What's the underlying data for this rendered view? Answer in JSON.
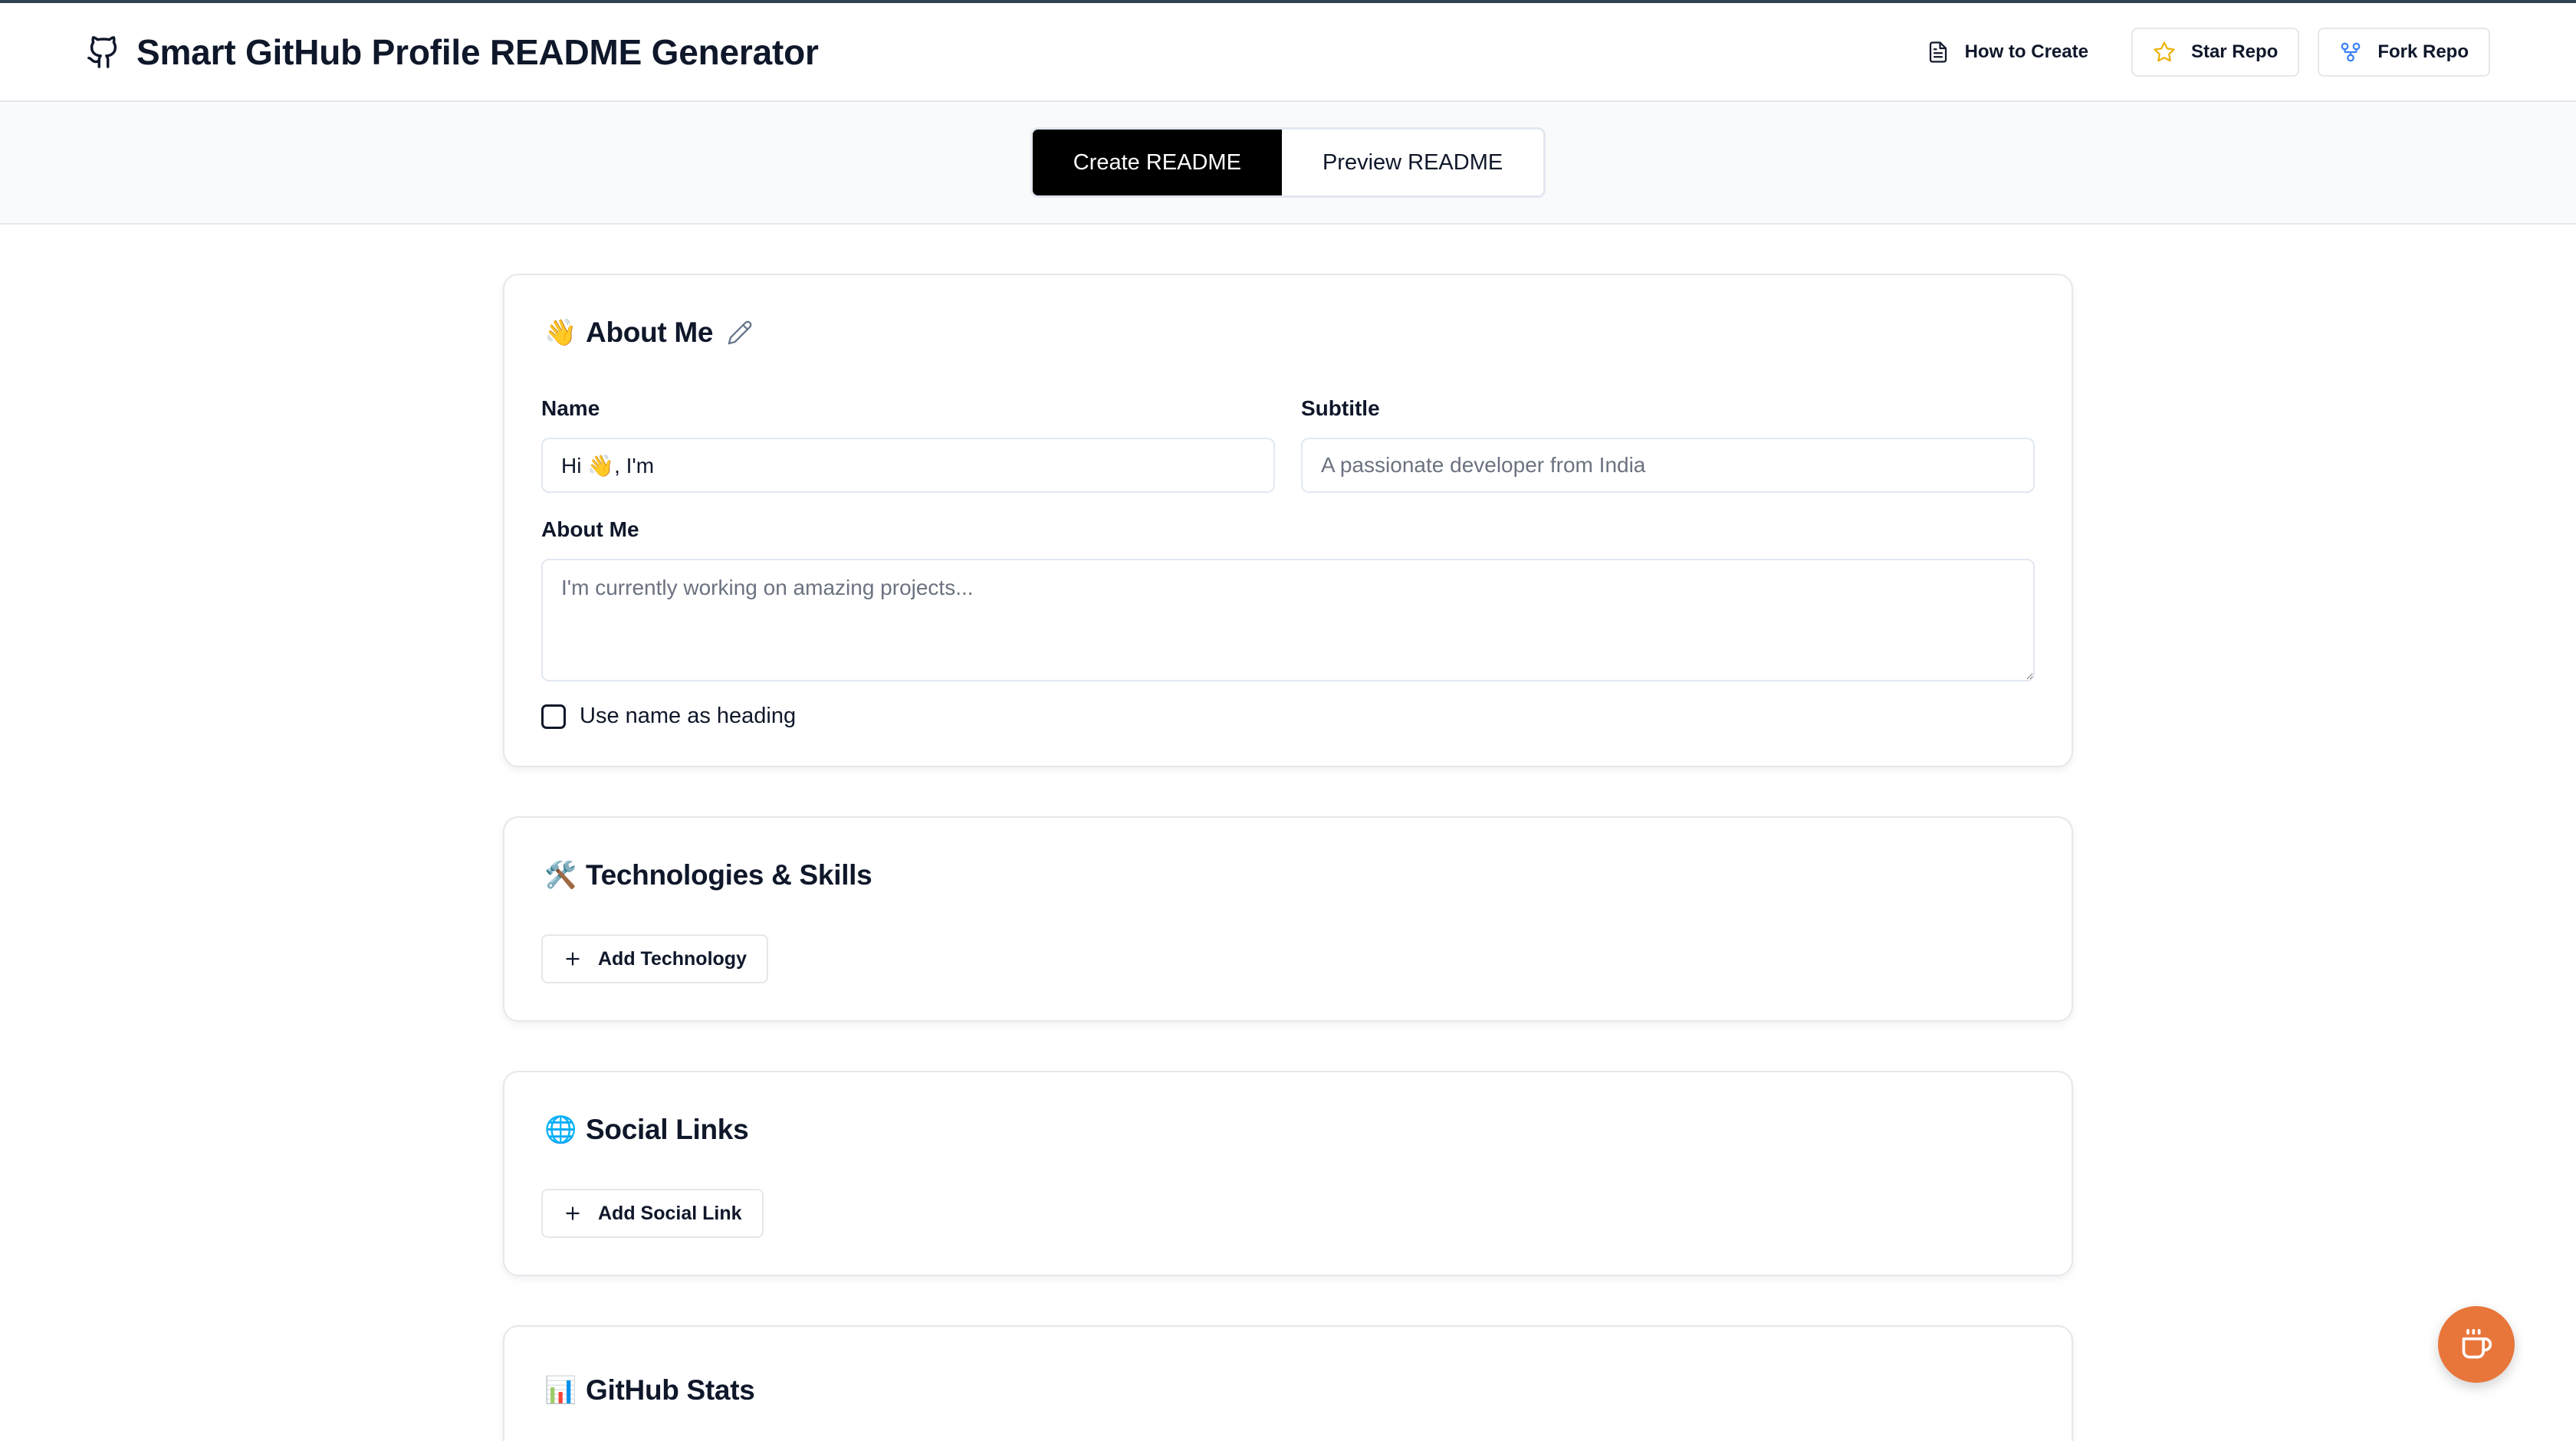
{
  "header": {
    "title": "Smart GitHub Profile README Generator",
    "how_to_label": "How to Create",
    "star_label": "Star Repo",
    "fork_label": "Fork Repo"
  },
  "tabs": [
    {
      "label": "Create README",
      "active": true
    },
    {
      "label": "Preview README",
      "active": false
    }
  ],
  "about": {
    "emoji": "👋",
    "title": "About Me",
    "name_label": "Name",
    "name_value": "Hi 👋, I'm",
    "subtitle_label": "Subtitle",
    "subtitle_placeholder": "A passionate developer from India",
    "about_label": "About Me",
    "about_placeholder": "I'm currently working on amazing projects...",
    "checkbox_label": "Use name as heading",
    "checkbox_checked": false
  },
  "technologies": {
    "emoji": "🛠️",
    "title": "Technologies & Skills",
    "add_label": "Add Technology"
  },
  "social": {
    "emoji": "🌐",
    "title": "Social Links",
    "add_label": "Add Social Link"
  },
  "stats": {
    "emoji": "📊",
    "title": "GitHub Stats"
  },
  "colors": {
    "active_tab": "#000000",
    "fab": "#e8763b",
    "star_icon": "#eab308",
    "fork_icon": "#3b82f6"
  },
  "icons": {
    "brand": "github-icon",
    "how_to": "document-icon",
    "star": "star-icon",
    "fork": "fork-icon",
    "edit": "pencil-icon",
    "add": "plus-icon",
    "fab": "coffee-icon"
  }
}
